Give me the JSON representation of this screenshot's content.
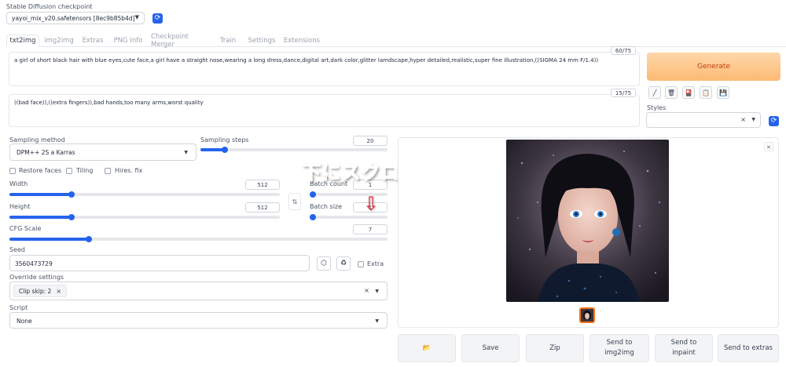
{
  "checkpoint": {
    "label": "Stable Diffusion checkpoint",
    "value": "yayoi_mix_v20.safetensors [8ec9b85b4d]"
  },
  "tabs": [
    "txt2img",
    "img2img",
    "Extras",
    "PNG Info",
    "Checkpoint Merger",
    "Train",
    "Settings",
    "Extensions"
  ],
  "prompt": {
    "text": "a girl of short black hair with blue eyes,cute face,a girl have a straight nose,wearing a long dress,dance,digital art,dark color,glitter lamdscape,hyper detailed,realistic,super fine illustration,((SIGMA 24 mm F/1.4))",
    "counter": "60/75"
  },
  "negative_prompt": {
    "text": "((bad face)),((extra fingers)),bad hands,too many arms,worst quality",
    "counter": "15/75"
  },
  "generate_label": "Generate",
  "styles_label": "Styles",
  "sampling_method": {
    "label": "Sampling method",
    "value": "DPM++ 2S a Karras"
  },
  "sampling_steps": {
    "label": "Sampling steps",
    "value": "20",
    "fraction": 0.13
  },
  "checkboxes": {
    "restore_faces": "Restore faces",
    "tiling": "Tiling",
    "hires_fix": "Hires. fix"
  },
  "width": {
    "label": "Width",
    "value": "512",
    "fraction": 0.23
  },
  "height": {
    "label": "Height",
    "value": "512",
    "fraction": 0.23
  },
  "batch_count": {
    "label": "Batch count",
    "value": "1",
    "fraction": 0.0
  },
  "batch_size": {
    "label": "Batch size",
    "value": "1",
    "fraction": 0.0
  },
  "cfg_scale": {
    "label": "CFG Scale",
    "value": "7",
    "fraction": 0.21
  },
  "seed": {
    "label": "Seed",
    "value": "3560473729",
    "extra_label": "Extra"
  },
  "override_settings": {
    "label": "Override settings",
    "chip": "Clip skip: 2"
  },
  "script": {
    "label": "Script",
    "value": "None"
  },
  "annotation": {
    "text": "下にスクロール",
    "arrow": "⇩"
  },
  "bottom_buttons": {
    "folder": "📂",
    "save": "Save",
    "zip": "Zip",
    "send_img2img": "Send to\nimg2img",
    "send_inpaint": "Send to\ninpaint",
    "send_extras": "Send to extras"
  },
  "colors": {
    "accent": "#2563eb",
    "generate_bg": "#fdba74",
    "generate_text": "#c2410c",
    "annotation_fill": "#e11d2e"
  }
}
